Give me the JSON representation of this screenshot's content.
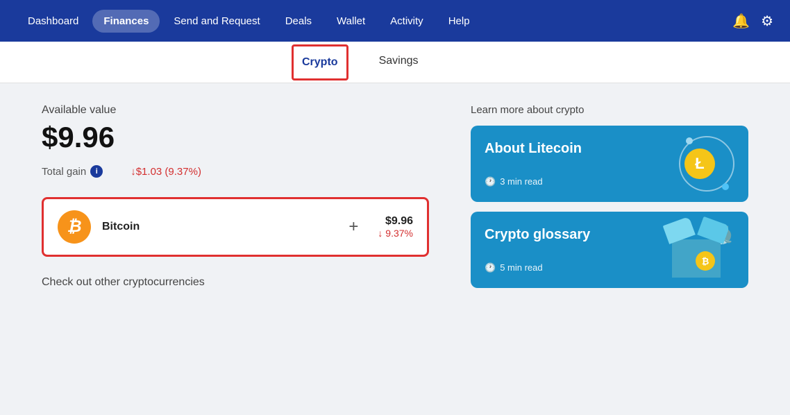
{
  "navbar": {
    "items": [
      {
        "label": "Dashboard",
        "active": false
      },
      {
        "label": "Finances",
        "active": true
      },
      {
        "label": "Send and Request",
        "active": false
      },
      {
        "label": "Deals",
        "active": false
      },
      {
        "label": "Wallet",
        "active": false
      },
      {
        "label": "Activity",
        "active": false
      },
      {
        "label": "Help",
        "active": false
      }
    ]
  },
  "tabs": [
    {
      "label": "Crypto",
      "active": true
    },
    {
      "label": "Savings",
      "active": false
    }
  ],
  "main": {
    "available_label": "Available value",
    "available_value": "$9.96",
    "total_gain_label": "Total gain",
    "total_gain_value": "↓$1.03 (9.37%)",
    "crypto_card": {
      "name": "Bitcoin",
      "usd_value": "$9.96",
      "pct_change": "↓ 9.37%"
    },
    "check_other_label": "Check out other cryptocurrencies"
  },
  "sidebar": {
    "learn_title": "Learn more about crypto",
    "cards": [
      {
        "title": "About Litecoin",
        "meta": "3 min read"
      },
      {
        "title": "Crypto glossary",
        "meta": "5 min read"
      }
    ]
  }
}
